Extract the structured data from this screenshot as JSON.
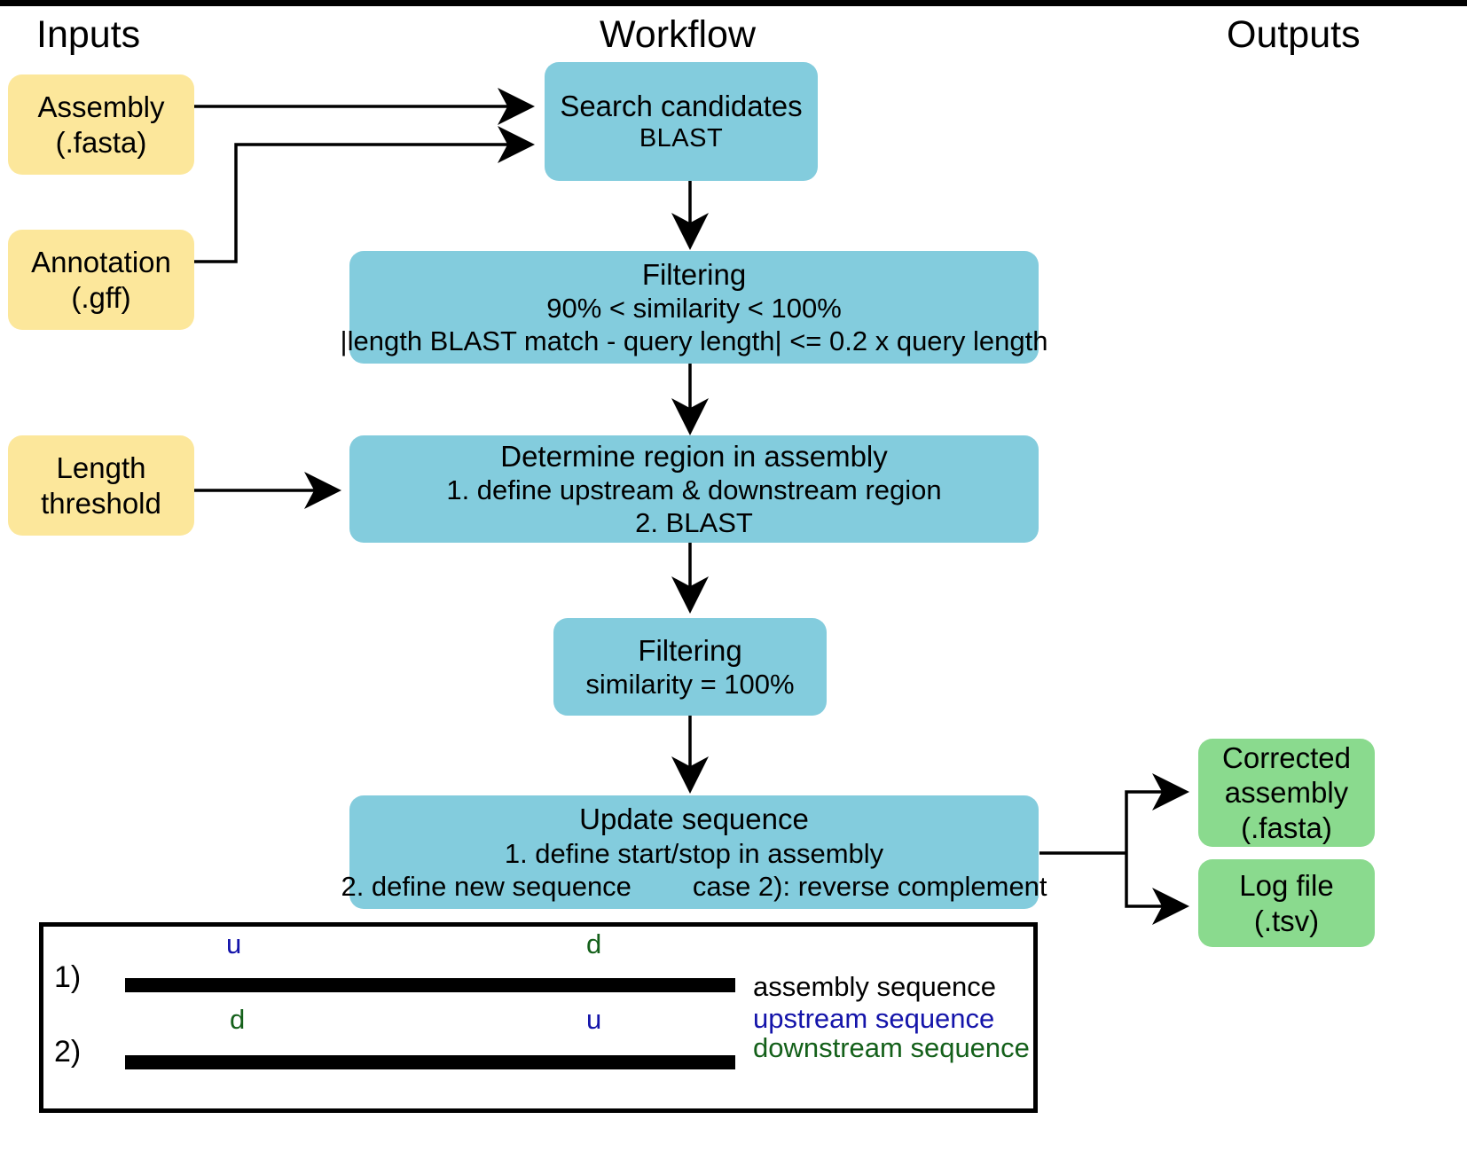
{
  "headers": {
    "inputs": "Inputs",
    "workflow": "Workflow",
    "outputs": "Outputs"
  },
  "colors": {
    "input_box": "#fce79b",
    "process_box": "#83ccdd",
    "output_box": "#8ada8e",
    "upstream": "#1414aa",
    "downstream": "#14601a",
    "assembly": "#000000"
  },
  "inputs": [
    {
      "line1": "Assembly",
      "line2": "(.fasta)"
    },
    {
      "line1": "Annotation",
      "line2": "(.gff)"
    },
    {
      "line1": "Length",
      "line2": "threshold"
    }
  ],
  "workflow": [
    {
      "title": "Search candidates",
      "lines": [
        "BLAST"
      ]
    },
    {
      "title": "Filtering",
      "lines": [
        "90% < similarity < 100%",
        "|length BLAST match - query length| <= 0.2 x query length"
      ]
    },
    {
      "title": "Determine region in assembly",
      "lines": [
        "1. define upstream & downstream region",
        "2. BLAST"
      ]
    },
    {
      "title": "Filtering",
      "lines": [
        "similarity = 100%"
      ]
    },
    {
      "title": "Update sequence",
      "lines": [
        "1. define start/stop in assembly",
        "2. define new sequence        case 2): reverse complement"
      ],
      "line2_left": "2. define new sequence",
      "line2_right": "case 2): reverse complement"
    }
  ],
  "outputs": [
    {
      "line1": "Corrected",
      "line2": "assembly",
      "line3": "(.fasta)"
    },
    {
      "line1": "Log file",
      "line2": "(.tsv)"
    }
  ],
  "legend": {
    "case1_index": "1)",
    "case2_index": "2)",
    "case1_upstream_label": "u",
    "case1_downstream_label": "d",
    "case2_downstream_label": "d",
    "case2_upstream_label": "u",
    "keys": [
      "assembly sequence",
      "upstream sequence",
      "downstream sequence"
    ]
  }
}
